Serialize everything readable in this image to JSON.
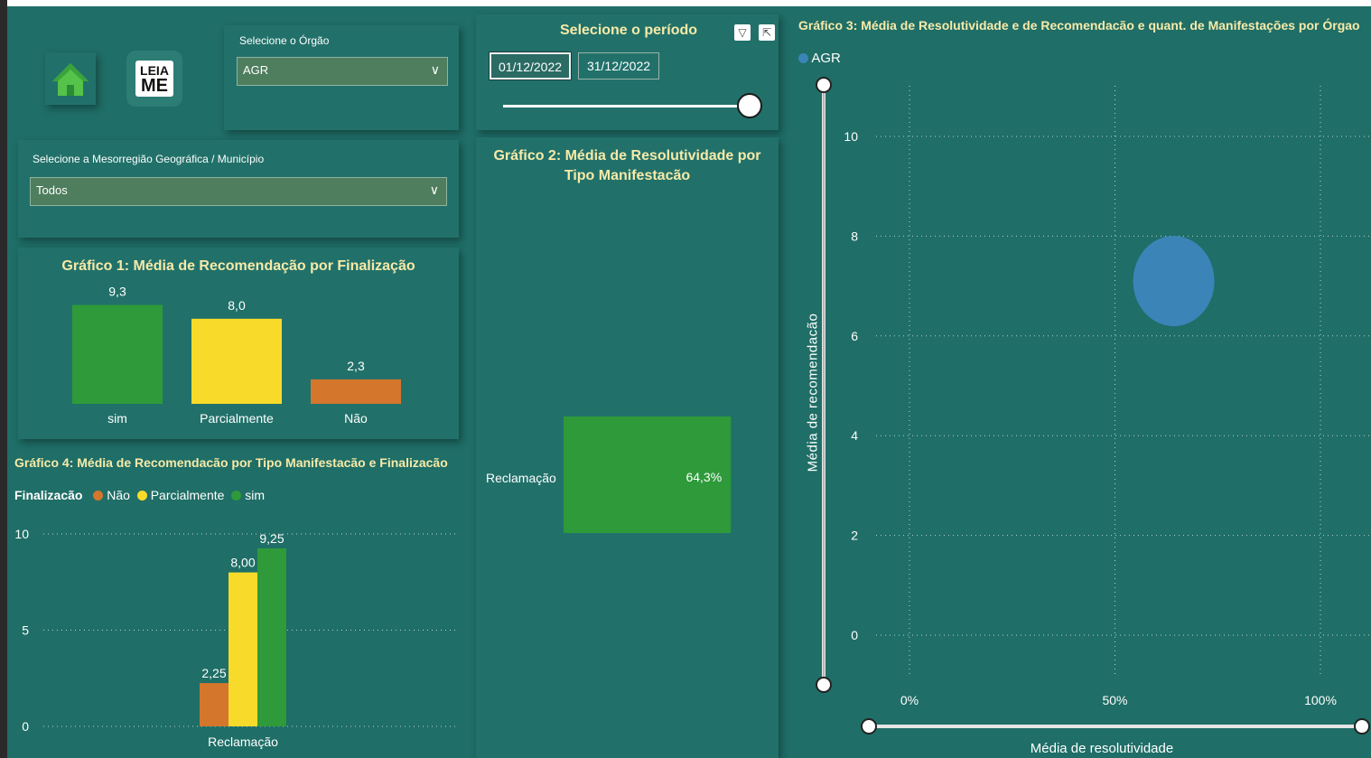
{
  "filters": {
    "orgao_label": "Selecione o Órgão",
    "orgao_value": "AGR",
    "mesorregiao_label": "Selecione a Mesorregião Geográfica / Município",
    "mesorregiao_value": "Todos",
    "periodo_label": "Selecione o período",
    "date_start": "01/12/2022",
    "date_end": "31/12/2022"
  },
  "leiame": {
    "line1": "LEIA",
    "line2": "ME"
  },
  "icons": {
    "home": "home-icon",
    "filter": "filter-icon",
    "focus": "focus-mode-icon",
    "chevron": "chevron-down-icon"
  },
  "colors": {
    "background": "#1f6e67",
    "title": "#f7eaa8",
    "green": "#2e9a3a",
    "yellow": "#f8db2a",
    "orange": "#d4762c",
    "bubble": "#3a84b8"
  },
  "chart1": {
    "title": "Gráfico 1: Média de Recomendação por Finalização",
    "chart_data": {
      "type": "bar",
      "categories": [
        "sim",
        "Parcialmente",
        "Não"
      ],
      "values": [
        9.3,
        8.0,
        2.3
      ],
      "labels": [
        "9,3",
        "8,0",
        "2,3"
      ],
      "colors": [
        "#2e9a3a",
        "#f8db2a",
        "#d4762c"
      ]
    }
  },
  "chart2": {
    "title": "Gráfico 2: Média de Resolutividade por Tipo Manifestacão",
    "chart_data": {
      "type": "bar",
      "categories": [
        "Reclamação"
      ],
      "values": [
        64.3
      ],
      "labels": [
        "64,3%"
      ],
      "color": "#2e9a3a"
    }
  },
  "chart3": {
    "title": "Gráfico 3: Média de Resolutividade e de Recomendacão e quant. de Manifestações por Órgao",
    "legend": "AGR",
    "xlabel": "Média de resolutividade",
    "ylabel": "Média de recomendacão",
    "xticks": [
      "0%",
      "50%",
      "100%"
    ],
    "yticks": [
      "0",
      "2",
      "4",
      "6",
      "8",
      "10"
    ],
    "chart_data": {
      "type": "scatter",
      "series": [
        {
          "name": "AGR",
          "x": [
            0.643
          ],
          "y": [
            7.1
          ]
        }
      ],
      "xlim": [
        0,
        1
      ],
      "ylim": [
        0,
        10
      ]
    }
  },
  "chart4": {
    "title": "Gráfico 4: Média de Recomendacão por Tipo Manifestacão e Finalizacão",
    "legend_title": "Finalizacão",
    "legend": [
      "Não",
      "Parcialmente",
      "sim"
    ],
    "yticks": [
      "10",
      "5",
      "0"
    ],
    "chart_data": {
      "type": "bar",
      "categories": [
        "Reclamação"
      ],
      "series": [
        {
          "name": "Não",
          "values": [
            2.25
          ],
          "label": "2,25",
          "color": "#d4762c"
        },
        {
          "name": "Parcialmente",
          "values": [
            8.0
          ],
          "label": "8,00",
          "color": "#f8db2a"
        },
        {
          "name": "sim",
          "values": [
            9.25
          ],
          "label": "9,25",
          "color": "#2e9a3a"
        }
      ],
      "ylim": [
        0,
        10
      ]
    }
  }
}
